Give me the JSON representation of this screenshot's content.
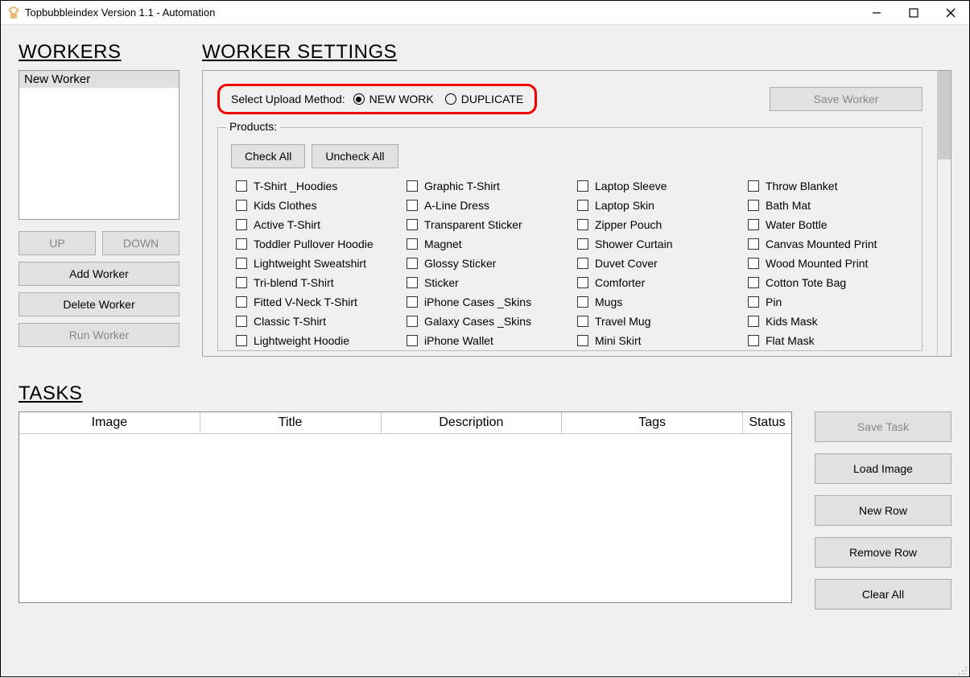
{
  "window": {
    "title": "Topbubbleindex Version 1.1 - Automation"
  },
  "workers": {
    "heading": "WORKERS",
    "items": [
      "New Worker"
    ],
    "up_label": "UP",
    "down_label": "DOWN",
    "add_label": "Add Worker",
    "delete_label": "Delete Worker",
    "run_label": "Run Worker"
  },
  "settings": {
    "heading": "WORKER SETTINGS",
    "upload_method_label": "Select Upload Method:",
    "radio_new_work": "NEW WORK",
    "radio_duplicate": "DUPLICATE",
    "save_worker_label": "Save Worker",
    "products_legend": "Products:",
    "check_all_label": "Check All",
    "uncheck_all_label": "Uncheck All",
    "products_col1": [
      "T-Shirt _Hoodies",
      "Kids Clothes",
      "Active T-Shirt",
      "Toddler Pullover Hoodie",
      "Lightweight Sweatshirt",
      "Tri-blend T-Shirt",
      "Fitted V-Neck T-Shirt",
      "Classic T-Shirt",
      "Lightweight Hoodie"
    ],
    "products_col2": [
      "Graphic T-Shirt",
      "A-Line Dress",
      "Transparent Sticker",
      "Magnet",
      "Glossy Sticker",
      "Sticker",
      "iPhone Cases _Skins",
      "Galaxy Cases _Skins",
      "iPhone Wallet"
    ],
    "products_col3": [
      "Laptop Sleeve",
      "Laptop Skin",
      "Zipper Pouch",
      "Shower Curtain",
      "Duvet Cover",
      "Comforter",
      "Mugs",
      "Travel Mug",
      "Mini Skirt"
    ],
    "products_col4": [
      "Throw Blanket",
      "Bath Mat",
      "Water Bottle",
      "Canvas Mounted Print",
      "Wood Mounted Print",
      "Cotton Tote Bag",
      "Pin",
      "Kids Mask",
      "Flat Mask"
    ]
  },
  "tasks": {
    "heading": "TASKS",
    "columns": {
      "image": "Image",
      "title": "Title",
      "description": "Description",
      "tags": "Tags",
      "status": "Status"
    },
    "save_task_label": "Save Task",
    "load_image_label": "Load Image",
    "new_row_label": "New Row",
    "remove_row_label": "Remove Row",
    "clear_all_label": "Clear All"
  }
}
